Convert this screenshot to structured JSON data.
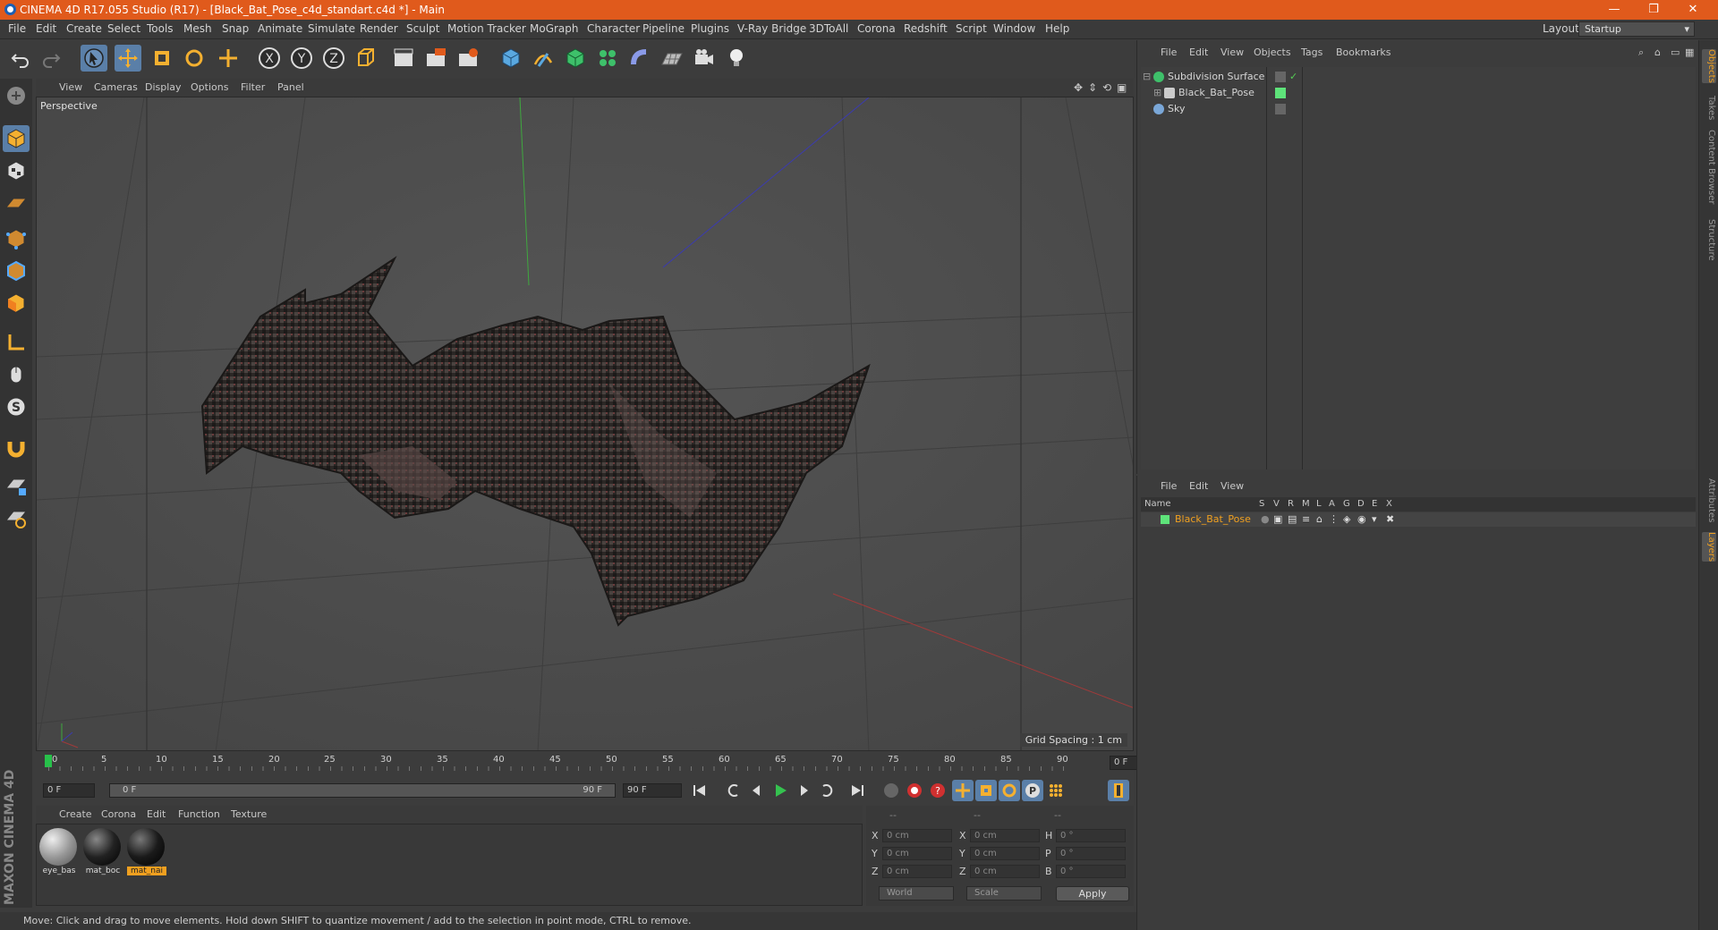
{
  "window": {
    "title": "CINEMA 4D R17.055 Studio (R17) - [Black_Bat_Pose_c4d_standart.c4d *] - Main",
    "minimize": "—",
    "maximize": "❐",
    "close": "✕"
  },
  "menubar": {
    "items": [
      "File",
      "Edit",
      "Create",
      "Select",
      "Tools",
      "Mesh",
      "Snap",
      "Animate",
      "Simulate",
      "Render",
      "Sculpt",
      "Motion Tracker",
      "MoGraph",
      "Character",
      "Pipeline",
      "Plugins",
      "V-Ray Bridge",
      "3DToAll",
      "Corona",
      "Redshift",
      "Script",
      "Window",
      "Help"
    ],
    "layout_label": "Layout:",
    "layout_value": "Startup"
  },
  "viewport": {
    "menu": [
      "View",
      "Cameras",
      "Display",
      "Options",
      "Filter",
      "Panel"
    ],
    "label": "Perspective",
    "grid_spacing": "Grid Spacing : 1 cm"
  },
  "timeline": {
    "ticks": [
      "0",
      "5",
      "10",
      "15",
      "20",
      "25",
      "30",
      "35",
      "40",
      "45",
      "50",
      "55",
      "60",
      "65",
      "70",
      "75",
      "80",
      "85",
      "90"
    ],
    "current_frame": "0 F",
    "start_field": "0 F",
    "range_start": "0 F",
    "range_end": "90 F",
    "end_field": "90 F"
  },
  "materials": {
    "menu": [
      "Create",
      "Corona",
      "Edit",
      "Function",
      "Texture"
    ],
    "items": [
      {
        "name": "eye_bas",
        "selected": false
      },
      {
        "name": "mat_boc",
        "selected": false
      },
      {
        "name": "mat_nai",
        "selected": true
      }
    ]
  },
  "coordinates": {
    "headers": [
      "--",
      "--",
      "--"
    ],
    "rows": [
      {
        "a": "X",
        "av": "0 cm",
        "b": "X",
        "bv": "0 cm",
        "c": "H",
        "cv": "0 °"
      },
      {
        "a": "Y",
        "av": "0 cm",
        "b": "Y",
        "bv": "0 cm",
        "c": "P",
        "cv": "0 °"
      },
      {
        "a": "Z",
        "av": "0 cm",
        "b": "Z",
        "bv": "0 cm",
        "c": "B",
        "cv": "0 °"
      }
    ],
    "space": "World",
    "mode": "Scale",
    "apply": "Apply"
  },
  "objects": {
    "menu": [
      "File",
      "Edit",
      "View",
      "Objects",
      "Tags",
      "Bookmarks"
    ],
    "items": [
      {
        "name": "Subdivision Surface",
        "color": "#4ab0d8"
      },
      {
        "name": "Black_Bat_Pose",
        "color": "#c8c8c8"
      },
      {
        "name": "Sky",
        "color": "#7aa7d8"
      }
    ]
  },
  "layers": {
    "menu": [
      "File",
      "Edit",
      "View"
    ],
    "columns": [
      "Name",
      "S",
      "V",
      "R",
      "M",
      "L",
      "A",
      "G",
      "D",
      "E",
      "X"
    ],
    "row_name": "Black_Bat_Pose",
    "row_color": "#5ee37a"
  },
  "side_tabs": [
    "Objects",
    "Takes",
    "Content Browser",
    "Structure",
    "Attributes",
    "Layers"
  ],
  "status": "Move: Click and drag to move elements. Hold down SHIFT to quantize movement / add to the selection in point mode, CTRL to remove.",
  "brand": "MAXON CINEMA 4D",
  "colors": {
    "titlebar": "#e05a1c",
    "selection": "#5a7fa8",
    "highlight": "#f0a020"
  }
}
